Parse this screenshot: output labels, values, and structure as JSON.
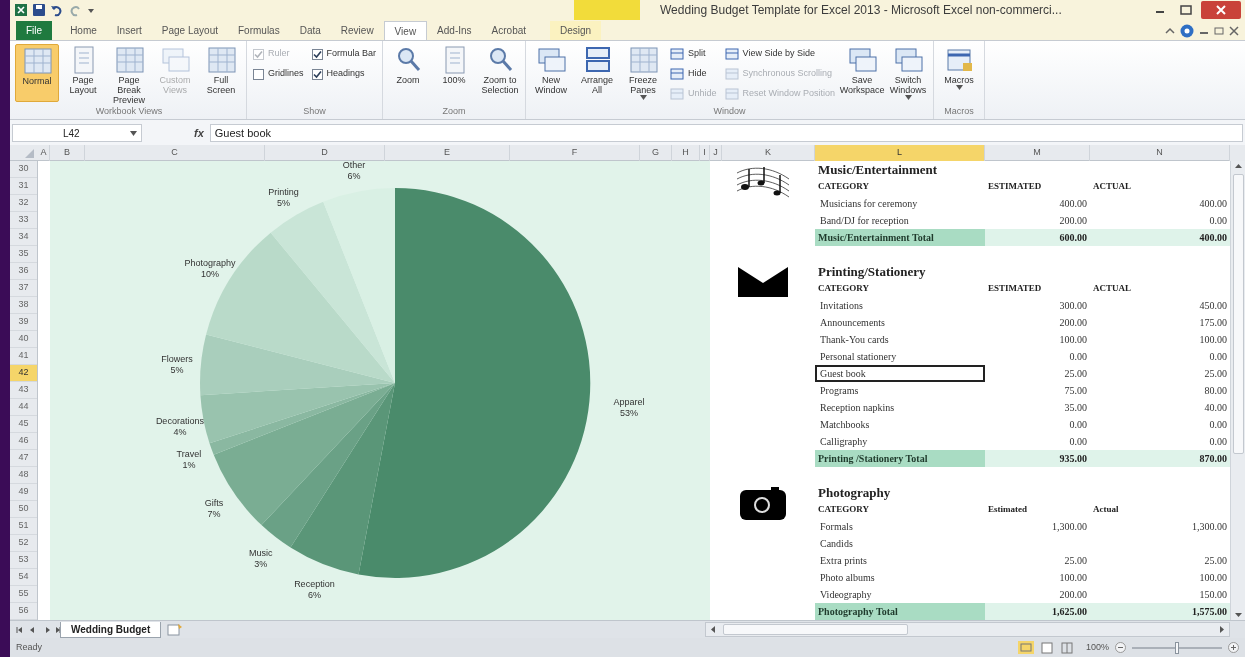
{
  "title_bar": {
    "title": "Wedding Budget Template for Excel 2013 - Microsoft Excel non-commerci..."
  },
  "tabs": [
    {
      "label": "File",
      "kind": "file",
      "selected": false
    },
    {
      "label": "Home",
      "kind": "normal",
      "selected": false
    },
    {
      "label": "Insert",
      "kind": "normal",
      "selected": false
    },
    {
      "label": "Page Layout",
      "kind": "normal",
      "selected": false
    },
    {
      "label": "Formulas",
      "kind": "normal",
      "selected": false
    },
    {
      "label": "Data",
      "kind": "normal",
      "selected": false
    },
    {
      "label": "Review",
      "kind": "normal",
      "selected": false
    },
    {
      "label": "View",
      "kind": "normal",
      "selected": true
    },
    {
      "label": "Add-Ins",
      "kind": "normal",
      "selected": false
    },
    {
      "label": "Acrobat",
      "kind": "normal",
      "selected": false
    },
    {
      "label": "Design",
      "kind": "contextual",
      "selected": false
    }
  ],
  "ribbon": {
    "groups": [
      {
        "label": "Workbook Views",
        "items": [
          {
            "kind": "large",
            "label": "Normal",
            "selected": true,
            "disabled": false
          },
          {
            "kind": "large",
            "label": "Page Layout",
            "selected": false,
            "disabled": false
          },
          {
            "kind": "large",
            "label": "Page Break Preview",
            "selected": false,
            "disabled": false
          },
          {
            "kind": "large",
            "label": "Custom Views",
            "selected": false,
            "disabled": true
          },
          {
            "kind": "large",
            "label": "Full Screen",
            "selected": false,
            "disabled": false
          }
        ]
      },
      {
        "label": "Show",
        "items": [
          {
            "kind": "check",
            "label": "Ruler",
            "checked": true,
            "disabled": true
          },
          {
            "kind": "check",
            "label": "Gridlines",
            "checked": false,
            "disabled": false
          },
          {
            "kind": "check",
            "label": "Formula Bar",
            "checked": true,
            "disabled": false
          },
          {
            "kind": "check",
            "label": "Headings",
            "checked": true,
            "disabled": false
          }
        ]
      },
      {
        "label": "Zoom",
        "items": [
          {
            "kind": "large",
            "label": "Zoom"
          },
          {
            "kind": "large",
            "label": "100%"
          },
          {
            "kind": "large",
            "label": "Zoom to Selection"
          }
        ]
      },
      {
        "label": "Window",
        "items": [
          {
            "kind": "large",
            "label": "New Window",
            "disabled": false
          },
          {
            "kind": "large",
            "label": "Arrange All",
            "disabled": false
          },
          {
            "kind": "large",
            "label": "Freeze Panes",
            "disabled": false,
            "menu": true
          },
          {
            "kind": "small",
            "label": "Split",
            "disabled": false
          },
          {
            "kind": "small",
            "label": "Hide",
            "disabled": false
          },
          {
            "kind": "small",
            "label": "Unhide",
            "disabled": true
          },
          {
            "kind": "small",
            "label": "View Side by Side",
            "disabled": false
          },
          {
            "kind": "small",
            "label": "Synchronous Scrolling",
            "disabled": true
          },
          {
            "kind": "small",
            "label": "Reset Window Position",
            "disabled": true
          },
          {
            "kind": "large",
            "label": "Save Workspace",
            "disabled": false
          },
          {
            "kind": "large",
            "label": "Switch Windows",
            "disabled": false,
            "menu": true
          }
        ]
      },
      {
        "label": "Macros",
        "items": [
          {
            "kind": "large",
            "label": "Macros",
            "menu": true
          }
        ]
      }
    ]
  },
  "formula_bar": {
    "name_box": "L42",
    "function_label": "fx",
    "value": "Guest book"
  },
  "column_headers": [
    {
      "label": "A",
      "selected": false
    },
    {
      "label": "B",
      "selected": false
    },
    {
      "label": "C",
      "selected": false
    },
    {
      "label": "D",
      "selected": false
    },
    {
      "label": "E",
      "selected": false
    },
    {
      "label": "F",
      "selected": false
    },
    {
      "label": "G",
      "selected": false
    },
    {
      "label": "H",
      "selected": false
    },
    {
      "label": "I",
      "selected": false
    },
    {
      "label": "J",
      "selected": false
    },
    {
      "label": "K",
      "selected": false
    },
    {
      "label": "L",
      "selected": true
    },
    {
      "label": "M",
      "selected": false
    },
    {
      "label": "N",
      "selected": false
    }
  ],
  "row_numbers": [
    {
      "label": "30",
      "selected": false
    },
    {
      "label": "31",
      "selected": false
    },
    {
      "label": "32",
      "selected": false
    },
    {
      "label": "33",
      "selected": false
    },
    {
      "label": "34",
      "selected": false
    },
    {
      "label": "35",
      "selected": false
    },
    {
      "label": "36",
      "selected": false
    },
    {
      "label": "37",
      "selected": false
    },
    {
      "label": "38",
      "selected": false
    },
    {
      "label": "39",
      "selected": false
    },
    {
      "label": "40",
      "selected": false
    },
    {
      "label": "41",
      "selected": false
    },
    {
      "label": "42",
      "selected": true
    },
    {
      "label": "43",
      "selected": false
    },
    {
      "label": "44",
      "selected": false
    },
    {
      "label": "45",
      "selected": false
    },
    {
      "label": "46",
      "selected": false
    },
    {
      "label": "47",
      "selected": false
    },
    {
      "label": "48",
      "selected": false
    },
    {
      "label": "49",
      "selected": false
    },
    {
      "label": "50",
      "selected": false
    },
    {
      "label": "51",
      "selected": false
    },
    {
      "label": "52",
      "selected": false
    },
    {
      "label": "53",
      "selected": false
    },
    {
      "label": "54",
      "selected": false
    },
    {
      "label": "55",
      "selected": false
    },
    {
      "label": "56",
      "selected": false
    }
  ],
  "chart": {
    "chart_data": {
      "type": "pie",
      "categories": [
        "Apparel",
        "Reception",
        "Music",
        "Gifts",
        "Travel",
        "Decorations",
        "Flowers",
        "Photography",
        "Printing",
        "Other"
      ],
      "values": [
        53,
        6,
        3,
        7,
        1,
        4,
        5,
        10,
        5,
        6
      ],
      "value_labels": [
        "53%",
        "6%",
        "3%",
        "7%",
        "1%",
        "4%",
        "5%",
        "10%",
        "5%",
        "6%"
      ]
    }
  },
  "sections": [
    {
      "title": "Music/Entertainment",
      "columns": [
        "CATEGORY",
        "ESTIMATED",
        "ACTUAL"
      ],
      "items": [
        {
          "label": "Musicians for ceremony",
          "estimated": "400.00",
          "actual": "400.00",
          "selected": false
        },
        {
          "label": "Band/DJ for reception",
          "estimated": "200.00",
          "actual": "0.00",
          "selected": false
        }
      ],
      "total": {
        "label": "Music/Entertainment Total",
        "estimated": "600.00",
        "actual": "400.00"
      }
    },
    {
      "title": "Printing/Stationery",
      "columns": [
        "CATEGORY",
        "ESTIMATED",
        "ACTUAL"
      ],
      "items": [
        {
          "label": "Invitations",
          "estimated": "300.00",
          "actual": "450.00",
          "selected": false
        },
        {
          "label": "Announcements",
          "estimated": "200.00",
          "actual": "175.00",
          "selected": false
        },
        {
          "label": "Thank-You cards",
          "estimated": "100.00",
          "actual": "100.00",
          "selected": false
        },
        {
          "label": "Personal stationery",
          "estimated": "0.00",
          "actual": "0.00",
          "selected": false
        },
        {
          "label": "Guest book",
          "estimated": "25.00",
          "actual": "25.00",
          "selected": true
        },
        {
          "label": "Programs",
          "estimated": "75.00",
          "actual": "80.00",
          "selected": false
        },
        {
          "label": "Reception napkins",
          "estimated": "35.00",
          "actual": "40.00",
          "selected": false
        },
        {
          "label": "Matchbooks",
          "estimated": "0.00",
          "actual": "0.00",
          "selected": false
        },
        {
          "label": "Calligraphy",
          "estimated": "0.00",
          "actual": "0.00",
          "selected": false
        }
      ],
      "total": {
        "label": "Printing /Stationery Total",
        "estimated": "935.00",
        "actual": "870.00"
      }
    },
    {
      "title": "Photography",
      "columns": [
        "CATEGORY",
        "Estimated",
        "Actual"
      ],
      "items": [
        {
          "label": "Formals",
          "estimated": "1,300.00",
          "actual": "1,300.00",
          "selected": false
        },
        {
          "label": "Candids",
          "selected": false
        },
        {
          "label": "Extra prints",
          "estimated": "25.00",
          "actual": "25.00",
          "selected": false
        },
        {
          "label": "Photo albums",
          "estimated": "100.00",
          "actual": "100.00",
          "selected": false
        },
        {
          "label": "Videography",
          "estimated": "200.00",
          "actual": "150.00",
          "selected": false
        }
      ],
      "total": {
        "label": "Photography Total",
        "estimated": "1,625.00",
        "actual": "1,575.00"
      }
    }
  ],
  "sheet_tabs": [
    {
      "label": "Wedding Budget",
      "selected": true
    }
  ],
  "status_bar": {
    "status": "Ready",
    "zoom": "100%",
    "zoom_slider": {
      "level": 0.5
    }
  }
}
